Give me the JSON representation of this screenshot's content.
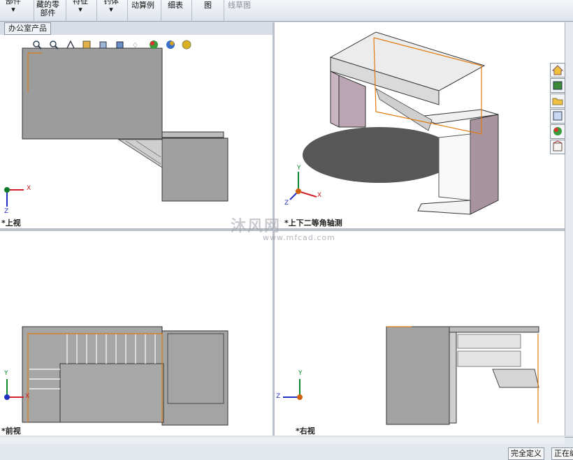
{
  "toolbar": {
    "items": [
      {
        "label": "部件",
        "sub": "▾"
      },
      {
        "label": "藏的零",
        "sub": "部件"
      },
      {
        "label": "特征",
        "sub": "▾"
      },
      {
        "label": "钓体",
        "sub": "▾"
      },
      {
        "label": "动算例",
        "sub": ""
      },
      {
        "label": "细表",
        "sub": ""
      },
      {
        "label": "图",
        "sub": ""
      },
      {
        "label": "线草图",
        "sub": ""
      }
    ]
  },
  "document_tab": "办公室产品",
  "window_controls": {
    "minimize": "–",
    "restore": "🗗",
    "close": "✕"
  },
  "viewports": {
    "top": {
      "label": "*上视"
    },
    "iso": {
      "label": "*上下二等角轴测"
    },
    "front": {
      "label": "*前视"
    },
    "right": {
      "label": "*右视"
    }
  },
  "axes": {
    "x": "X",
    "y": "Y",
    "z": "Z"
  },
  "watermark": {
    "main": "沐风网",
    "sub": "www.mfcad.com"
  },
  "status": {
    "state": "完全定义",
    "editing": "正在编"
  },
  "colors": {
    "orange": "#e07a10",
    "gray": "#9a9a9a",
    "bg": "#ffffff"
  }
}
